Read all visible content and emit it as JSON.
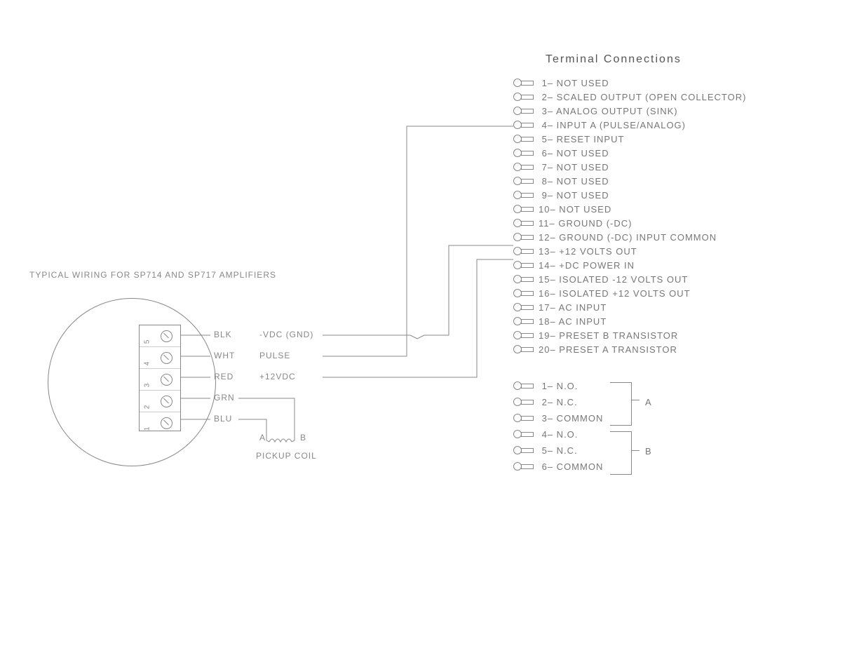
{
  "titles": {
    "main": "Terminal  Connections",
    "left": "TYPICAL WIRING FOR SP714 AND SP717 AMPLIFIERS"
  },
  "main_terminals": [
    {
      "num": "1",
      "desc": "NOT USED"
    },
    {
      "num": "2",
      "desc": "SCALED OUTPUT (OPEN COLLECTOR)"
    },
    {
      "num": "3",
      "desc": "ANALOG OUTPUT (SINK)"
    },
    {
      "num": "4",
      "desc": "INPUT A (PULSE/ANALOG)"
    },
    {
      "num": "5",
      "desc": "RESET INPUT"
    },
    {
      "num": "6",
      "desc": "NOT USED"
    },
    {
      "num": "7",
      "desc": "NOT USED"
    },
    {
      "num": "8",
      "desc": "NOT USED"
    },
    {
      "num": "9",
      "desc": "NOT USED"
    },
    {
      "num": "10",
      "desc": "NOT USED"
    },
    {
      "num": "11",
      "desc": "GROUND (-DC)"
    },
    {
      "num": "12",
      "desc": "GROUND (-DC) INPUT COMMON"
    },
    {
      "num": "13",
      "desc": "+12 VOLTS OUT"
    },
    {
      "num": "14",
      "desc": "+DC POWER IN"
    },
    {
      "num": "15",
      "desc": "ISOLATED -12 VOLTS OUT"
    },
    {
      "num": "16",
      "desc": "ISOLATED +12 VOLTS OUT"
    },
    {
      "num": "17",
      "desc": "AC INPUT"
    },
    {
      "num": "18",
      "desc": "AC INPUT"
    },
    {
      "num": "19",
      "desc": "PRESET B TRANSISTOR"
    },
    {
      "num": "20",
      "desc": "PRESET A TRANSISTOR"
    }
  ],
  "relay_terminals": [
    {
      "num": "1",
      "desc": "N.O."
    },
    {
      "num": "2",
      "desc": "N.C."
    },
    {
      "num": "3",
      "desc": "COMMON"
    },
    {
      "num": "4",
      "desc": "N.O."
    },
    {
      "num": "5",
      "desc": "N.C."
    },
    {
      "num": "6",
      "desc": "COMMON"
    }
  ],
  "relay_groups": {
    "a": "A",
    "b": "B"
  },
  "left_wires": [
    {
      "num": "5",
      "color": "BLK",
      "signal": "-VDC (GND)"
    },
    {
      "num": "4",
      "color": "WHT",
      "signal": "PULSE"
    },
    {
      "num": "3",
      "color": "RED",
      "signal": "+12VDC"
    },
    {
      "num": "2",
      "color": "GRN",
      "signal": ""
    },
    {
      "num": "1",
      "color": "BLU",
      "signal": ""
    }
  ],
  "pickup": {
    "a": "A",
    "b": "B",
    "label": "PICKUP COIL"
  }
}
